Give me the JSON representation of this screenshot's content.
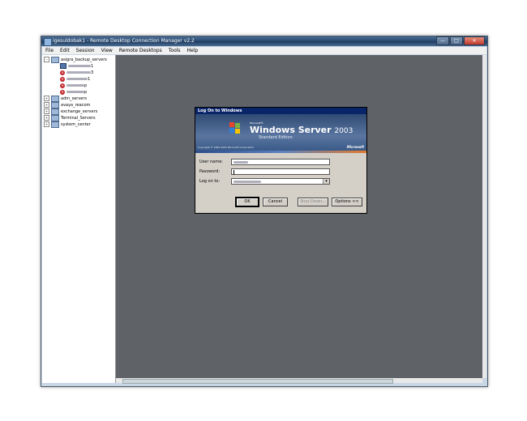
{
  "window": {
    "title": "igesuldobak1 - Remote Desktop Connection Manager v2.2",
    "buttons": {
      "minimize": "—",
      "maximize": "□",
      "close": "✕"
    }
  },
  "menu": [
    "File",
    "Edit",
    "Session",
    "View",
    "Remote Desktops",
    "Tools",
    "Help"
  ],
  "tree": {
    "group_open": "asigra_backup_servers",
    "servers_suffix": [
      "1",
      "3",
      "1",
      "p",
      "p"
    ],
    "groups": [
      "adm_servers",
      "avaya_reacom",
      "exchange_servers",
      "Terminal_Servers",
      "system_center"
    ],
    "expander_minus": "−",
    "expander_plus": "+"
  },
  "dialog": {
    "title": "Log On to Windows",
    "microsoft_small": "Microsoft®",
    "product": "Windows Server",
    "product_year": "2003",
    "edition": "Standard Edition",
    "copyright": "Copyright © 1985-2003  Microsoft Corporation",
    "ms_logo": "Microsoft",
    "labels": {
      "user": "User name:",
      "password": "Password:",
      "logon": "Log on to:"
    },
    "buttons": {
      "ok": "OK",
      "cancel": "Cancel",
      "shutdown": "Shut Down...",
      "options": "Options <<"
    }
  },
  "colors": {
    "desktop": "#5f6267",
    "titlebar": "#0a246a"
  }
}
